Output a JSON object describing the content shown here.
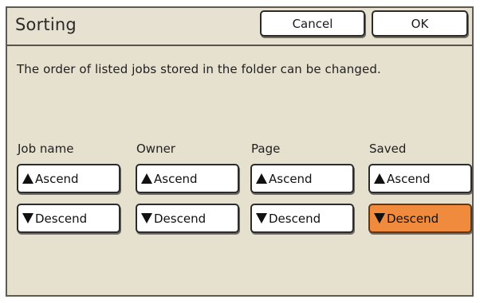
{
  "dialog": {
    "title": "Sorting",
    "cancel_label": "Cancel",
    "ok_label": "OK",
    "message": "The order of listed jobs stored in the folder can be changed."
  },
  "columns": [
    {
      "label": "Job name",
      "ascend_label": "Ascend",
      "descend_label": "Descend"
    },
    {
      "label": "Owner",
      "ascend_label": "Ascend",
      "descend_label": "Descend"
    },
    {
      "label": "Page",
      "ascend_label": "Ascend",
      "descend_label": "Descend"
    },
    {
      "label": "Saved",
      "ascend_label": "Ascend",
      "descend_label": "Descend"
    }
  ],
  "selected": {
    "column": "Saved",
    "order": "Descend"
  },
  "colors": {
    "background": "#e6e0cf",
    "selected_button": "#f08a3c",
    "button": "#ffffff",
    "border": "#2b2b2b"
  },
  "icons": {
    "ascend": "triangle-up-icon",
    "descend": "triangle-down-icon"
  }
}
